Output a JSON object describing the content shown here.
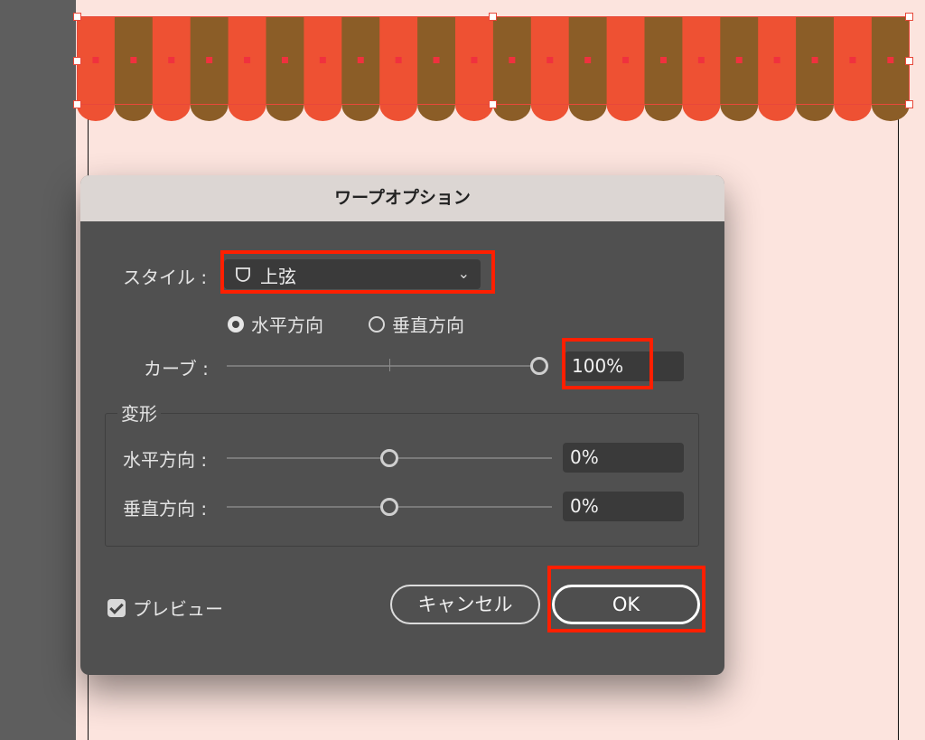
{
  "dialog": {
    "title": "ワープオプション",
    "style_label": "スタイル :",
    "style_value": "上弦",
    "orientation": {
      "horizontal_label": "水平方向",
      "vertical_label": "垂直方向",
      "selected": "horizontal"
    },
    "bend": {
      "label": "カーブ :",
      "value": "100%",
      "level": 100
    },
    "distortion": {
      "group_label": "変形",
      "horizontal": {
        "label": "水平方向 :",
        "value": "0%",
        "level": 0
      },
      "vertical": {
        "label": "垂直方向 :",
        "value": "0%",
        "level": 0
      }
    },
    "preview_label": "プレビュー",
    "preview_checked": true,
    "cancel_label": "キャンセル",
    "ok_label": "OK"
  },
  "colors": {
    "awning_red": "#ee5133",
    "awning_brown": "#8b5d27",
    "artboard": "#fce4de",
    "highlight": "#ff1f00"
  },
  "icons": {
    "style_icon": "shield-icon",
    "dropdown": "chevron-down-icon"
  }
}
